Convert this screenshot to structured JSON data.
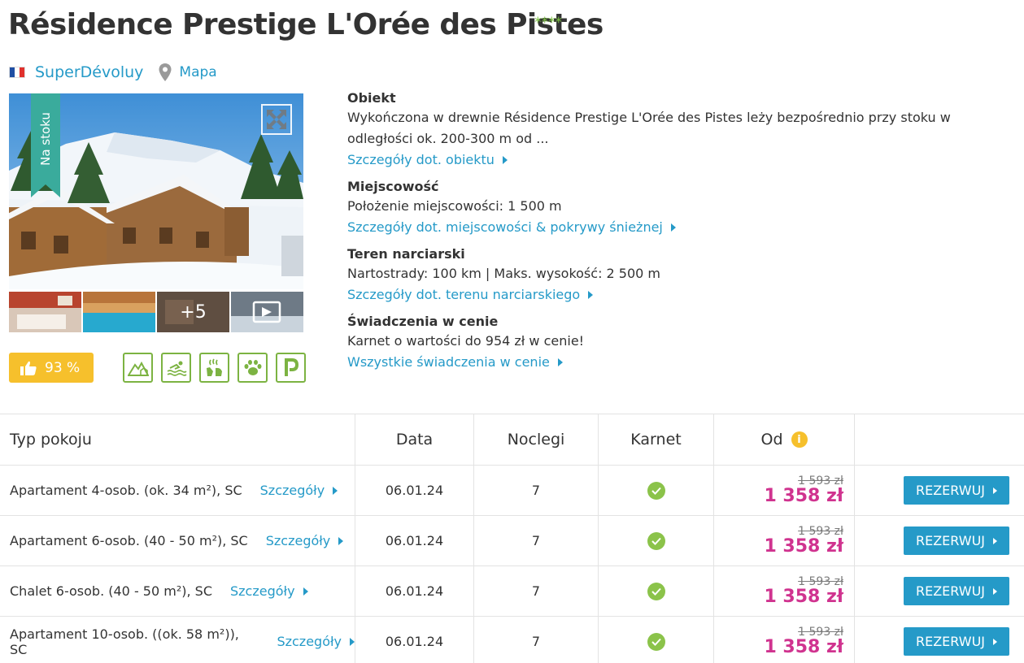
{
  "hotel": {
    "title": "Résidence Prestige L'Orée des Pistes",
    "stars": "****",
    "region": "SuperDévoluy",
    "map_label": "Mapa",
    "ribbon_label": "Na stoku",
    "thumbs_more": "+5",
    "rating": "93 %"
  },
  "amenities": [
    "mountain-icon",
    "swimming-icon",
    "spa-icon",
    "pets-icon",
    "parking-icon"
  ],
  "info": {
    "obiekt": {
      "heading": "Obiekt",
      "text": "Wykończona w drewnie Résidence Prestige L'Orée des Pistes leży bezpośrednio przy stoku w odległości ok. 200-300 m od ...",
      "link": "Szczegóły dot. obiektu"
    },
    "miejscowosc": {
      "heading": "Miejscowość",
      "text": "Położenie miejscowości: 1 500 m",
      "link": "Szczegóły dot. miejscowości & pokrywy śnieżnej"
    },
    "teren": {
      "heading": "Teren narciarski",
      "text": "Nartostrady: 100 km | Maks. wysokość: 2 500 m",
      "link": "Szczegóły dot. terenu narciarskiego"
    },
    "swiadczenia": {
      "heading": "Świadczenia w cenie",
      "text": "Karnet o wartości do 954 zł w cenie!",
      "link": "Wszystkie świadczenia w cenie"
    }
  },
  "table": {
    "headers": {
      "room": "Typ pokoju",
      "date": "Data",
      "nights": "Noclegi",
      "pass": "Karnet",
      "from": "Od",
      "info_mark": "i"
    },
    "details_label": "Szczegóły",
    "book_label": "REZERWUJ",
    "rows": [
      {
        "room": "Apartament 4-osob. (ok. 34 m²), SC",
        "date": "06.01.24",
        "nights": "7",
        "old_price": "1 593 zł",
        "price": "1 358 zł"
      },
      {
        "room": "Apartament 6-osob. (40 - 50 m²), SC",
        "date": "06.01.24",
        "nights": "7",
        "old_price": "1 593 zł",
        "price": "1 358 zł"
      },
      {
        "room": "Chalet 6-osob. (40 - 50 m²), SC",
        "date": "06.01.24",
        "nights": "7",
        "old_price": "1 593 zł",
        "price": "1 358 zł"
      },
      {
        "room": "Apartament 10-osob. ((ok. 58 m²)), SC",
        "date": "06.01.24",
        "nights": "7",
        "old_price": "1 593 zł",
        "price": "1 358 zł"
      }
    ]
  },
  "colors": {
    "link": "#259ac8",
    "price": "#d0338f",
    "rating": "#f6c02c",
    "amenity": "#7cb342",
    "ribbon": "#3aab9c"
  }
}
